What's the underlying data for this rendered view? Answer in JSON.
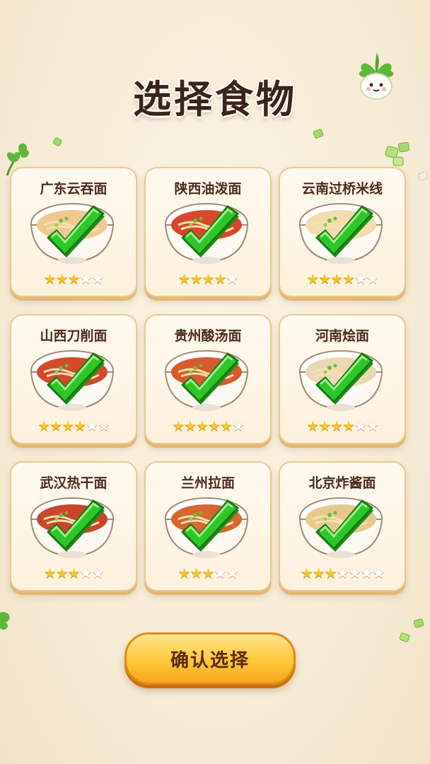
{
  "title": "选择食物",
  "confirm_label": "确认选择",
  "foods": [
    {
      "name": "广东云吞面",
      "stars": 3,
      "max_stars": 5,
      "selected": true,
      "soup_color": "#f1c890"
    },
    {
      "name": "陕西油泼面",
      "stars": 4,
      "max_stars": 5,
      "selected": true,
      "soup_color": "#d8472b"
    },
    {
      "name": "云南过桥米线",
      "stars": 4,
      "max_stars": 6,
      "selected": true,
      "soup_color": "#f2dcb0"
    },
    {
      "name": "山西刀削面",
      "stars": 4,
      "max_stars": 6,
      "selected": true,
      "soup_color": "#d34a2a"
    },
    {
      "name": "贵州酸汤面",
      "stars": 5,
      "max_stars": 6,
      "selected": true,
      "soup_color": "#d95a2c"
    },
    {
      "name": "河南烩面",
      "stars": 4,
      "max_stars": 6,
      "selected": true,
      "soup_color": "#ead7b4"
    },
    {
      "name": "武汉热干面",
      "stars": 3,
      "max_stars": 5,
      "selected": true,
      "soup_color": "#c9462a"
    },
    {
      "name": "兰州拉面",
      "stars": 3,
      "max_stars": 5,
      "selected": true,
      "soup_color": "#d8662f"
    },
    {
      "name": "北京炸酱面",
      "stars": 3,
      "max_stars": 7,
      "selected": true,
      "soup_color": "#e7c98e"
    }
  ],
  "colors": {
    "check": "#2fc62a",
    "star_on": "#f7c52a",
    "button": "#ffc83a"
  }
}
